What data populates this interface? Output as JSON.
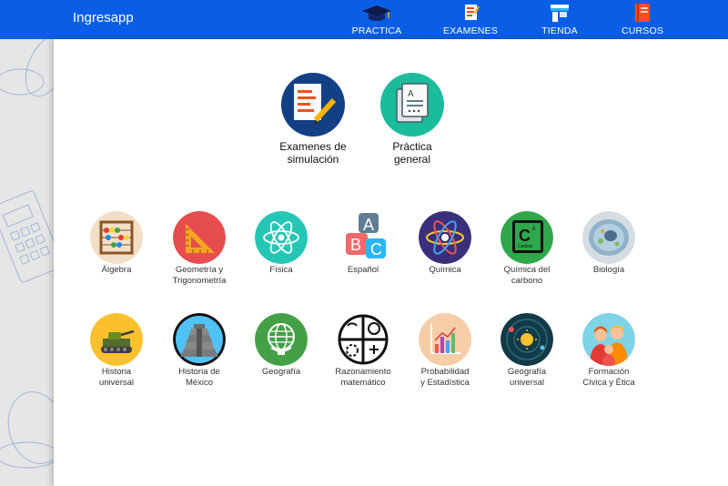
{
  "app": {
    "title": "Ingresapp"
  },
  "nav": [
    {
      "label": "PRACTICA",
      "icon": "graduation-cap-icon"
    },
    {
      "label": "EXAMENES",
      "icon": "exam-document-icon"
    },
    {
      "label": "TIENDA",
      "icon": "store-icon"
    },
    {
      "label": "CURSOS",
      "icon": "course-book-icon"
    }
  ],
  "modes": [
    {
      "label_line1": "Examenes de",
      "label_line2": "simulación",
      "icon": "exam-pencil-icon"
    },
    {
      "label_line1": "Práctica",
      "label_line2": "general",
      "icon": "documents-icon"
    }
  ],
  "subjects_row1": [
    {
      "line1": "Álgebra",
      "line2": "",
      "icon": "abacus-icon"
    },
    {
      "line1": "Geometría y",
      "line2": "Trigonometría",
      "icon": "set-square-icon"
    },
    {
      "line1": "Física",
      "line2": "",
      "icon": "atom-icon"
    },
    {
      "line1": "Español",
      "line2": "",
      "icon": "abc-blocks-icon"
    },
    {
      "line1": "Química",
      "line2": "",
      "icon": "molecule-icon"
    },
    {
      "line1": "Química del",
      "line2": "carbono",
      "icon": "carbon-element-icon"
    },
    {
      "line1": "Biología",
      "line2": "",
      "icon": "cell-icon"
    }
  ],
  "subjects_row2": [
    {
      "line1": "Historia",
      "line2": "universal",
      "icon": "tank-icon"
    },
    {
      "line1": "Historia de",
      "line2": "México",
      "icon": "pyramid-icon"
    },
    {
      "line1": "Geografía",
      "line2": "",
      "icon": "globe-icon"
    },
    {
      "line1": "Razonamiento",
      "line2": "matemático",
      "icon": "puzzle-icon"
    },
    {
      "line1": "Probabilidad",
      "line2": "y Estadística",
      "icon": "bar-chart-icon"
    },
    {
      "line1": "Geografía",
      "line2": "universal",
      "icon": "solar-system-icon"
    },
    {
      "line1": "Formación",
      "line2": "Cívica y Ética",
      "icon": "family-icon"
    }
  ],
  "colors": {
    "header": "#0a5ee6",
    "background": "#e6e6e6",
    "panel": "#ffffff"
  }
}
